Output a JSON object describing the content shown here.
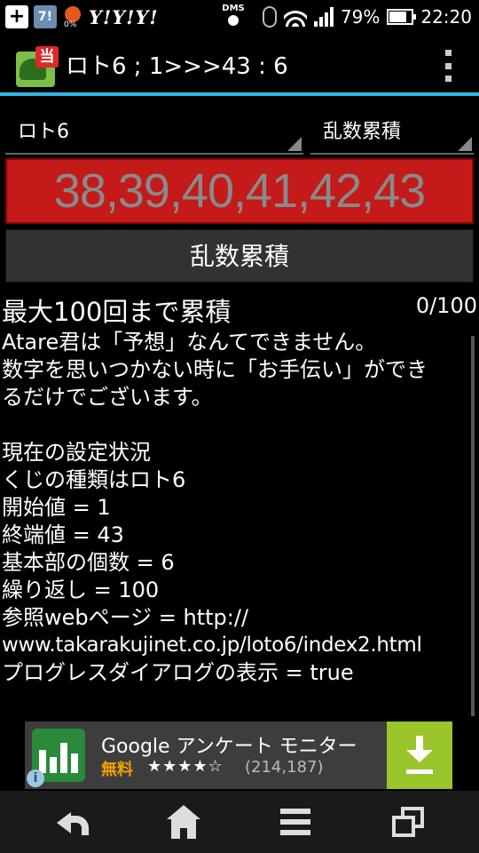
{
  "status_bar": {
    "notification_badge": "7!",
    "yahoo_icons": "Y!Y!Y!",
    "weather_percent": "0%",
    "dms_label": "DMS",
    "battery": "79%",
    "time": "22:20"
  },
  "app_bar": {
    "icon_tag": "当",
    "title": "ロト6 ; 1>>>43 : 6"
  },
  "spinners": {
    "lottery_type": "ロト6",
    "mode": "乱数累積"
  },
  "numbers_display": "38,39,40,41,42,43",
  "action_button_label": "乱数累積",
  "content": {
    "heading": "最大100回まで累積",
    "counter": "0/100",
    "lines": [
      "Atare君は「予想」なんてできません。",
      "数字を思いつかない時に「お手伝い」ができ",
      "るだけでございます。",
      "",
      "現在の設定状況",
      "くじの種類はロト6",
      "開始値 = 1",
      "終端値 = 43",
      "基本部の個数 = 6",
      "繰り返し = 100",
      "参照webページ = http://",
      "www.takarakujinet.co.jp/loto6/index2.html",
      "プログレスダイアログの表示 = true"
    ]
  },
  "ad": {
    "app_name": "Google アンケート モニター",
    "price": "無料",
    "stars": "★★★★☆",
    "rating_count": "(214,187)",
    "info": "i"
  },
  "colors": {
    "accent": "#33b5e5",
    "number_box": "#c41a1a",
    "ad_download": "#9ac52b"
  }
}
